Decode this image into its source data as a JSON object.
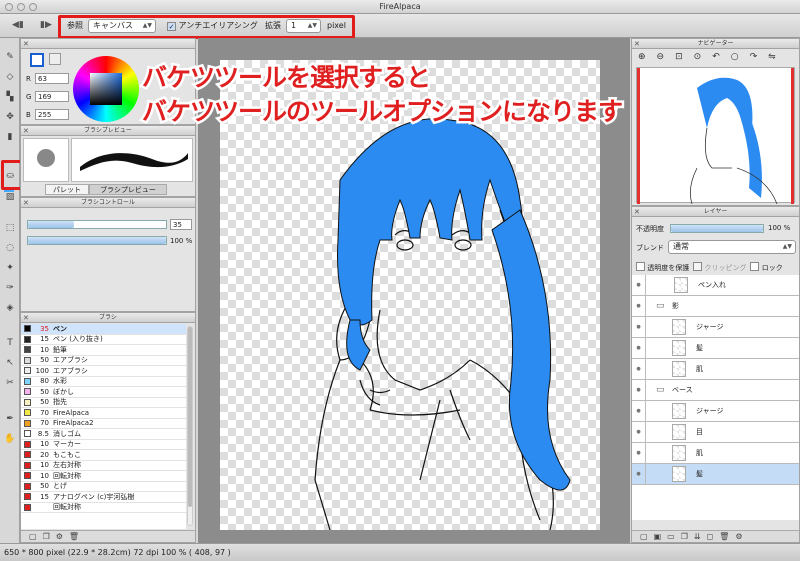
{
  "window": {
    "title": "FireAlpaca"
  },
  "toolbar": {
    "ref_label": "参照",
    "ref_value": "キャンバス",
    "antialias_label": "アンチエイリアシング",
    "expand_label": "拡張",
    "expand_value": "1",
    "unit": "pixel"
  },
  "color_panel": {
    "r_label": "R",
    "r": "63",
    "g_label": "G",
    "g": "169",
    "b_label": "B",
    "b": "255",
    "primary_color": "#3fa9ff"
  },
  "brush_preview": {
    "title": "ブラシプレビュー",
    "tab_palette": "パレット",
    "tab_preview": "ブラシプレビュー"
  },
  "brush_control": {
    "title": "ブラシコントロール",
    "size": "35",
    "opacity": "100 %",
    "size_fraction": 0.33,
    "opacity_fraction": 1.0
  },
  "brush_list": {
    "title": "ブラシ",
    "items": [
      {
        "size": "35",
        "name": "ペン",
        "color": "#000000"
      },
      {
        "size": "15",
        "name": "ペン (入り抜き)",
        "color": "#222222"
      },
      {
        "size": "10",
        "name": "鉛筆",
        "color": "#444444"
      },
      {
        "size": "50",
        "name": "エアブラシ",
        "color": "#dddddd"
      },
      {
        "size": "100",
        "name": "エアブラシ",
        "color": "#eeeeee"
      },
      {
        "size": "80",
        "name": "水彩",
        "color": "#7fd3ff"
      },
      {
        "size": "50",
        "name": "ぼかし",
        "color": "#f4b3ee"
      },
      {
        "size": "50",
        "name": "指先",
        "color": "#f7f0c0"
      },
      {
        "size": "70",
        "name": "FireAlpaca",
        "color": "#f1e84a"
      },
      {
        "size": "70",
        "name": "FireAlpaca2",
        "color": "#f0a020"
      },
      {
        "size": "8.5",
        "name": "消しゴム",
        "color": "#ffffff"
      },
      {
        "size": "10",
        "name": "マーカー",
        "color": "#e02020"
      },
      {
        "size": "20",
        "name": "もこもこ",
        "color": "#e02020"
      },
      {
        "size": "10",
        "name": "左右対称",
        "color": "#e02020"
      },
      {
        "size": "10",
        "name": "回転対称",
        "color": "#e02020"
      },
      {
        "size": "50",
        "name": "とげ",
        "color": "#e02020"
      },
      {
        "size": "15",
        "name": "アナログペン (c)宇河弘樹",
        "color": "#e02020"
      },
      {
        "size": "",
        "name": "回転対称",
        "color": "#e02020"
      }
    ]
  },
  "navigator": {
    "title": "ナビゲーター"
  },
  "layers": {
    "title": "レイヤー",
    "opacity_label": "不透明度",
    "opacity_value": "100 %",
    "blend_label": "ブレンド",
    "blend_value": "通常",
    "protect_label": "透明度を保護",
    "clip_label": "クリッピング",
    "lock_label": "ロック",
    "items": [
      {
        "name": "ペン入れ",
        "type": "layer"
      },
      {
        "name": "影",
        "type": "folder"
      },
      {
        "name": "ジャージ",
        "type": "layer"
      },
      {
        "name": "髪",
        "type": "layer"
      },
      {
        "name": "肌",
        "type": "layer"
      },
      {
        "name": "ベース",
        "type": "folder"
      },
      {
        "name": "ジャージ",
        "type": "layer"
      },
      {
        "name": "目",
        "type": "layer"
      },
      {
        "name": "肌",
        "type": "layer"
      },
      {
        "name": "髪",
        "type": "layer"
      }
    ]
  },
  "overlay": {
    "line1": "バケツツールを選択すると",
    "line2": "バケツツールのツールオプションになります",
    "color": "#e02020"
  },
  "status": {
    "text": "650 * 800 pixel   (22.9 * 28.2cm)   72 dpi   100 %   ( 408, 97 )"
  }
}
